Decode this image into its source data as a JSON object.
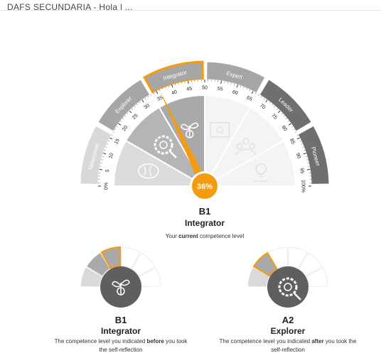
{
  "header": {
    "title": "DAFS SECUNDARIA - Hola | ..."
  },
  "main_gauge": {
    "percent_label": "36%",
    "percent_value": 36,
    "segments": [
      {
        "label": "Newcomer",
        "color": "#d8d8d8"
      },
      {
        "label": "Explorer",
        "color": "#a6a6a6"
      },
      {
        "label": "Integrator",
        "color": "#a6a6a6"
      },
      {
        "label": "Expert",
        "color": "#a6a6a6"
      },
      {
        "label": "Leader",
        "color": "#6f6f6f"
      },
      {
        "label": "Pioneer",
        "color": "#6f6f6f"
      }
    ],
    "ticks": [
      "0%",
      "5",
      "10",
      "15",
      "20",
      "25",
      "30",
      "35",
      "40",
      "45",
      "50",
      "55",
      "60",
      "65",
      "70",
      "75",
      "80",
      "85",
      "90",
      "95",
      "100%"
    ],
    "level_code": "B1",
    "level_name": "Integrator",
    "caption_pre": "Your ",
    "caption_bold": "current",
    "caption_post": " competence level"
  },
  "before_panel": {
    "level_code": "B1",
    "level_name": "Integrator",
    "caption_pre": "The competence level you indicated ",
    "caption_bold": "before",
    "caption_post": " you took",
    "caption_line2": "the self-reflection"
  },
  "after_panel": {
    "level_code": "A2",
    "level_name": "Explorer",
    "caption_pre": "The competence level you indicated ",
    "caption_bold": "after",
    "caption_post": " you took the",
    "caption_line2": "self-reflection"
  },
  "colors": {
    "accent": "#f39c12",
    "dark_gray": "#6f6f6f",
    "mid_gray": "#a6a6a6",
    "light_gray": "#d8d8d8"
  }
}
